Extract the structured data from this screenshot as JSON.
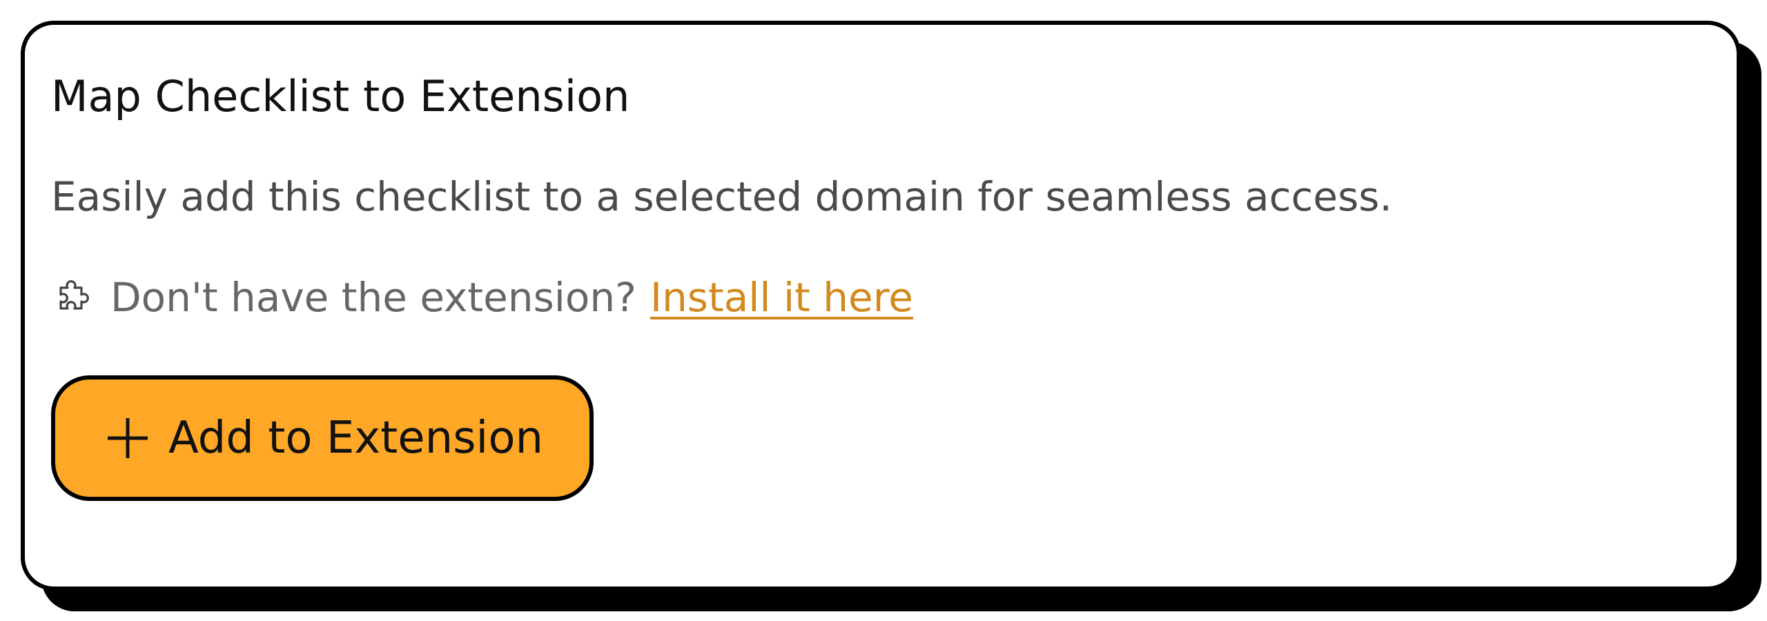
{
  "card": {
    "title": "Map Checklist to Extension",
    "description": "Easily add this checklist to a selected domain for seamless access.",
    "install_prompt": "Don't have the extension?",
    "install_link": "Install it here",
    "add_button_label": "Add to Extension"
  },
  "icons": {
    "prompt_icon": "puzzle-icon",
    "button_icon": "plus-icon"
  },
  "colors": {
    "accent": "#ffa726",
    "link": "#d28a1e",
    "border": "#000000"
  }
}
